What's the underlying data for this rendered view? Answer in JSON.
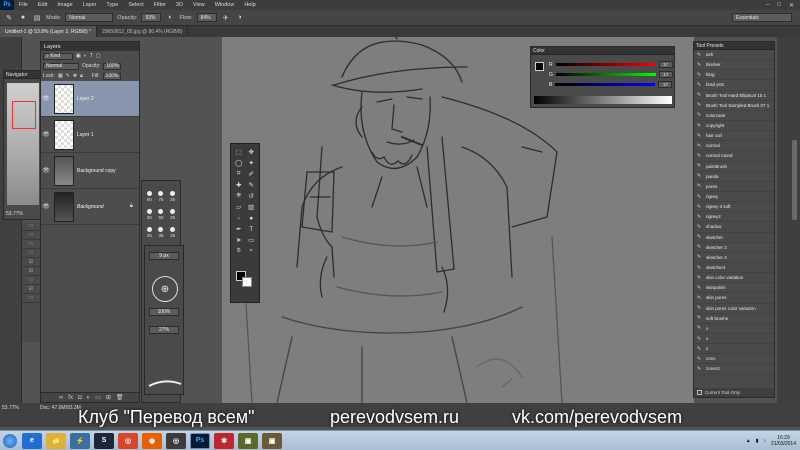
{
  "menubar": {
    "logo": "Ps",
    "items": [
      "File",
      "Edit",
      "Image",
      "Layer",
      "Type",
      "Select",
      "Filter",
      "3D",
      "View",
      "Window",
      "Help"
    ],
    "window_controls": [
      "–",
      "□",
      "✕"
    ]
  },
  "options_bar": {
    "mode_label": "Mode:",
    "mode_value": "Normal",
    "opacity_label": "Opacity:",
    "opacity_value": "93%",
    "flow_label": "Flow:",
    "flow_value": "84%",
    "workspace": "Essentials"
  },
  "tabs": [
    {
      "label": "Untitled-1 @ 53.8% (Layer 2, RGB/8) *",
      "active": true
    },
    {
      "label": "29650812_05.jpg @ 86.4% (RGB/8)",
      "active": false
    }
  ],
  "navigator": {
    "title": "Navigator",
    "zoom": "53.77%"
  },
  "layers_panel": {
    "title": "Layers",
    "kind_label": "Kind",
    "blend_mode": "Normal",
    "opacity_label": "Opacity:",
    "opacity_value": "100%",
    "lock_label": "Lock:",
    "fill_label": "Fill:",
    "fill_value": "100%",
    "layers": [
      {
        "name": "Layer 2",
        "selected": true
      },
      {
        "name": "Layer 1",
        "selected": false
      },
      {
        "name": "Background copy",
        "selected": false
      },
      {
        "name": "Background",
        "selected": false
      }
    ]
  },
  "brush_panel": {
    "sizes": [
      "60",
      "75",
      "25",
      "30",
      "50",
      "25",
      "25",
      "36",
      "25",
      "200",
      "25",
      "200"
    ],
    "size_field": "9 px",
    "hardness": "100%",
    "spacing": "27%"
  },
  "color_panel": {
    "title": "Color",
    "r_label": "R",
    "g_label": "G",
    "b_label": "B",
    "r": "17",
    "g": "17",
    "b": "17"
  },
  "tool_presets": {
    "title": "Tool Presets",
    "items": [
      "ash",
      "blocker",
      "blog",
      "brad ysts",
      "Brush Tool Hard Elliptical 15 1",
      "Brush Tool Sampled Brush 07 1",
      "colorcase",
      "copyright",
      "hair curl",
      "normal",
      "normal round",
      "paintbrush",
      "panda",
      "pores",
      "rigney",
      "rigney 3 soft",
      "rigney2",
      "shadow",
      "sketcher",
      "sketcher 2",
      "sketcher 3",
      "sketcher4",
      "skin color variation",
      "skinpolish",
      "skin pores",
      "skin pores color variation",
      "soft brushe",
      "x",
      "x",
      "x",
      "zonx",
      "zoner2"
    ],
    "footer_label": "Current Tool Only"
  },
  "status_bar": {
    "zoom": "53.77%",
    "doc": "Doc: 47.6M/93.3M"
  },
  "watermark": {
    "club": "Клуб \"Перевод всем\"",
    "site": "perevodvsem.ru",
    "vk": "vk.com/perevodvsem"
  },
  "taskbar": {
    "apps": [
      "e",
      "📁",
      "⚡",
      "S",
      "◎",
      "◉",
      "◎",
      "Ps",
      "✱",
      "▣",
      "▣"
    ],
    "clock_time": "16:29",
    "clock_date": "21/03/2014"
  },
  "colors": {
    "panel_bg": "#4d4d4d",
    "selected_layer": "#8896ad",
    "canvas_bg": "#7d7e80",
    "photoshop_blue": "#31a8ff"
  }
}
